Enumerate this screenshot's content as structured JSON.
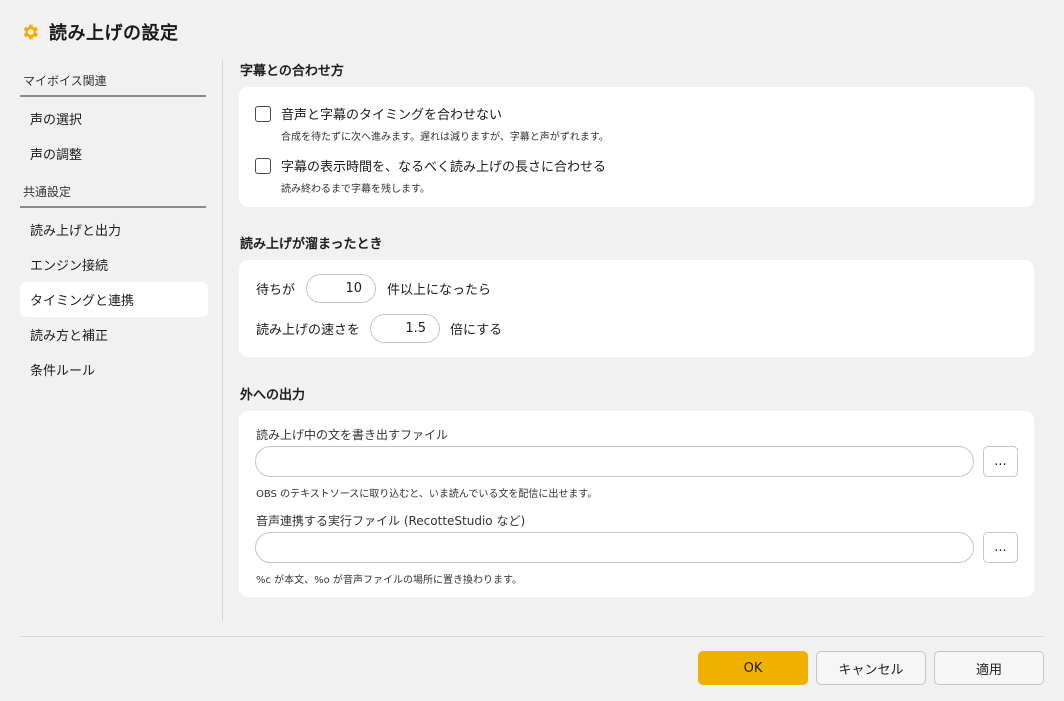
{
  "window": {
    "title": "読み上げの設定",
    "icon": "gear-icon",
    "accent": "#f0b000"
  },
  "sidebar": {
    "groups": [
      {
        "header": "マイボイス関連",
        "items": [
          "声の選択",
          "声の調整"
        ]
      },
      {
        "header": "共通設定",
        "items": [
          "読み上げと出力",
          "エンジン接続",
          "タイミングと連携",
          "読み方と補正",
          "条件ルール"
        ]
      }
    ],
    "active_item": "タイミングと連携"
  },
  "sections": {
    "subtitle_sync": {
      "title": "字幕との合わせ方",
      "opt1_label": "音声と字幕のタイミングを合わせない",
      "opt1_checked": false,
      "opt1_hint": "合成を待たずに次へ進みます。遅れは減りますが、字幕と声がずれます。",
      "opt2_label": "字幕の表示時間を、なるべく読み上げの長さに合わせる",
      "opt2_checked": false,
      "opt2_hint": "読み終わるまで字幕を残します。"
    },
    "backlog": {
      "title": "読み上げが溜まったとき",
      "row1_prefix": "待ちが",
      "row1_value": "10",
      "row1_suffix": "件以上になったら",
      "row2_prefix": "読み上げの速さを",
      "row2_value": "1.5",
      "row2_suffix": "倍にする"
    },
    "output": {
      "title": "外への出力",
      "file_label": "読み上げ中の文を書き出すファイル",
      "file_value": "",
      "file_hint": "OBS のテキストソースに取り込むと、いま読んでいる文を配信に出せます。",
      "exe_label": "音声連携する実行ファイル (RecotteStudio など)",
      "exe_value": "",
      "exe_hint": "%c が本文、%o が音声ファイルの場所に置き換わります。",
      "browse_label": "..."
    }
  },
  "footer": {
    "ok": "OK",
    "cancel": "キャンセル",
    "apply": "適用"
  }
}
